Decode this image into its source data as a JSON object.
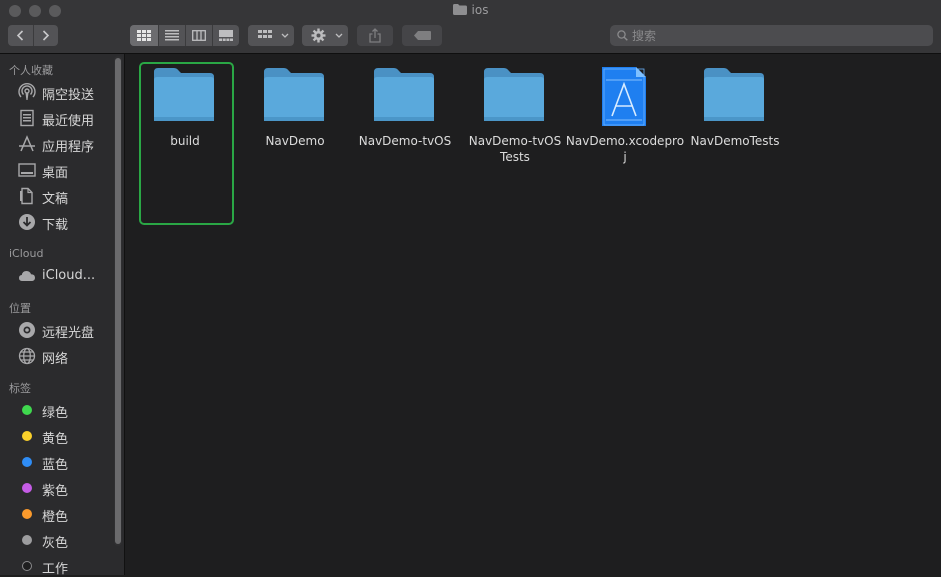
{
  "window": {
    "title": "ios"
  },
  "toolbar": {
    "search_placeholder": "搜索",
    "view_icons": [
      "icon-view-icon",
      "list-view-icon",
      "column-view-icon",
      "gallery-view-icon"
    ]
  },
  "sidebar": {
    "favorites_header": "个人收藏",
    "favorites": [
      {
        "label": "隔空投送",
        "icon": "airdrop-icon"
      },
      {
        "label": "最近使用",
        "icon": "recents-icon"
      },
      {
        "label": "应用程序",
        "icon": "applications-icon"
      },
      {
        "label": "桌面",
        "icon": "desktop-icon"
      },
      {
        "label": "文稿",
        "icon": "documents-icon"
      },
      {
        "label": "下载",
        "icon": "downloads-icon"
      }
    ],
    "icloud_header": "iCloud",
    "icloud": [
      {
        "label": "iCloud...",
        "icon": "icloud-icon"
      }
    ],
    "locations_header": "位置",
    "locations": [
      {
        "label": "远程光盘",
        "icon": "remote-disc-icon"
      },
      {
        "label": "网络",
        "icon": "network-icon"
      }
    ],
    "tags_header": "标签",
    "tags": [
      {
        "label": "绿色",
        "color": "#3fd84e"
      },
      {
        "label": "黄色",
        "color": "#fbd12b"
      },
      {
        "label": "蓝色",
        "color": "#2f8df6"
      },
      {
        "label": "紫色",
        "color": "#c55ce6"
      },
      {
        "label": "橙色",
        "color": "#fb9a2c"
      },
      {
        "label": "灰色",
        "color": "#9d9d9f"
      },
      {
        "label": "工作",
        "color": "#1e1e1f"
      }
    ]
  },
  "files": [
    {
      "name": "build",
      "type": "folder",
      "selected": true
    },
    {
      "name": "NavDemo",
      "type": "folder"
    },
    {
      "name": "NavDemo-tvOS",
      "type": "folder"
    },
    {
      "name": "NavDemo-tvOSTests",
      "type": "folder"
    },
    {
      "name": "NavDemo.xcodeproj",
      "type": "xcodeproj"
    },
    {
      "name": "NavDemoTests",
      "type": "folder"
    }
  ],
  "colors": {
    "selection": "#2aa745",
    "folder": "#5aa9dc"
  }
}
